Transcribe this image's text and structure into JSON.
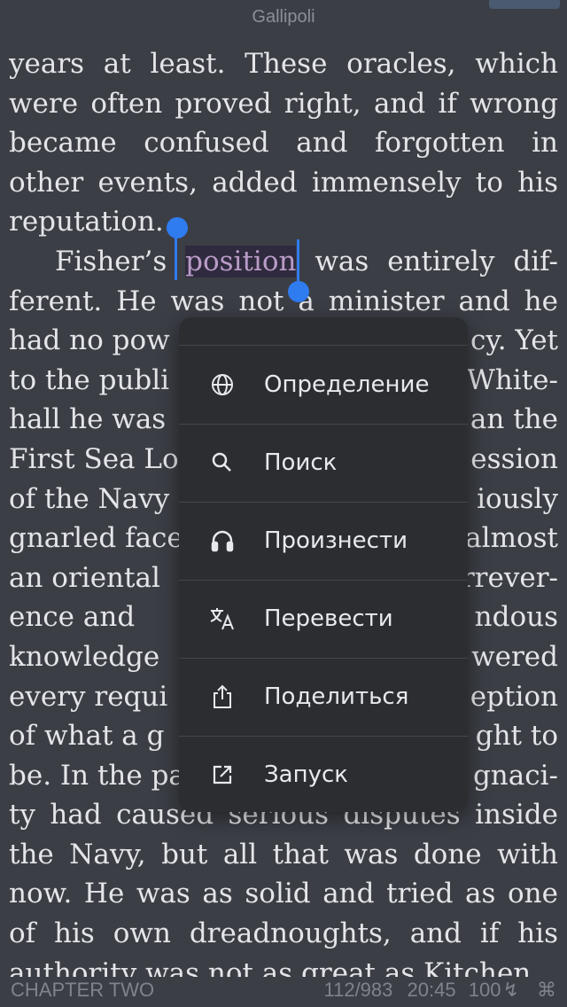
{
  "header": {
    "title": "Gallipoli"
  },
  "text": {
    "lines": [
      "years at least. These oracles, which",
      "were often proved right, and if wrong",
      "became confused and forgotten in",
      "other events, added immensely to his",
      "reputation."
    ],
    "line6_before": "Fisher’s ",
    "selected_word": "position",
    "line6_after": " was entirely dif-",
    "lines_after": [
      "ferent. He was not a minister and he",
      "had no pow",
      "to the publi",
      "hall he was",
      "First Sea Lo",
      "of the Navy",
      "gnarled face",
      "an oriental",
      "ence and",
      "knowledge",
      "every requi",
      "of what a g",
      "be. In the pa",
      "ty had caused serious disputes inside",
      "the Navy, but all that was done with",
      "now. He was as solid and tried as one",
      "of his own dreadnoughts, and if his"
    ],
    "right_fragments": [
      "cy. Yet",
      "White-",
      "an the",
      "ession",
      "iously",
      "almost",
      "rrever-",
      "ndous",
      "wered",
      "eption",
      "ght to",
      "gnaci-"
    ],
    "partial_bottom": "authority was not as great as Kitchen"
  },
  "context_menu": {
    "items": [
      {
        "label": "Определение",
        "icon": "globe-icon"
      },
      {
        "label": "Поиск",
        "icon": "search-icon"
      },
      {
        "label": "Произнести",
        "icon": "headphones-icon"
      },
      {
        "label": "Перевести",
        "icon": "translate-icon"
      },
      {
        "label": "Поделиться",
        "icon": "share-icon"
      },
      {
        "label": "Запуск",
        "icon": "open-external-icon"
      }
    ]
  },
  "footer": {
    "chapter": "CHAPTER TWO",
    "page": "112/983",
    "time": "20:45",
    "battery": "100",
    "battery_icon": "charging-icon",
    "extra_icon": "command-icon"
  },
  "colors": {
    "background": "#3b3e45",
    "selection_handle": "#2f7bf0",
    "menu_background": "#2b2d31"
  }
}
